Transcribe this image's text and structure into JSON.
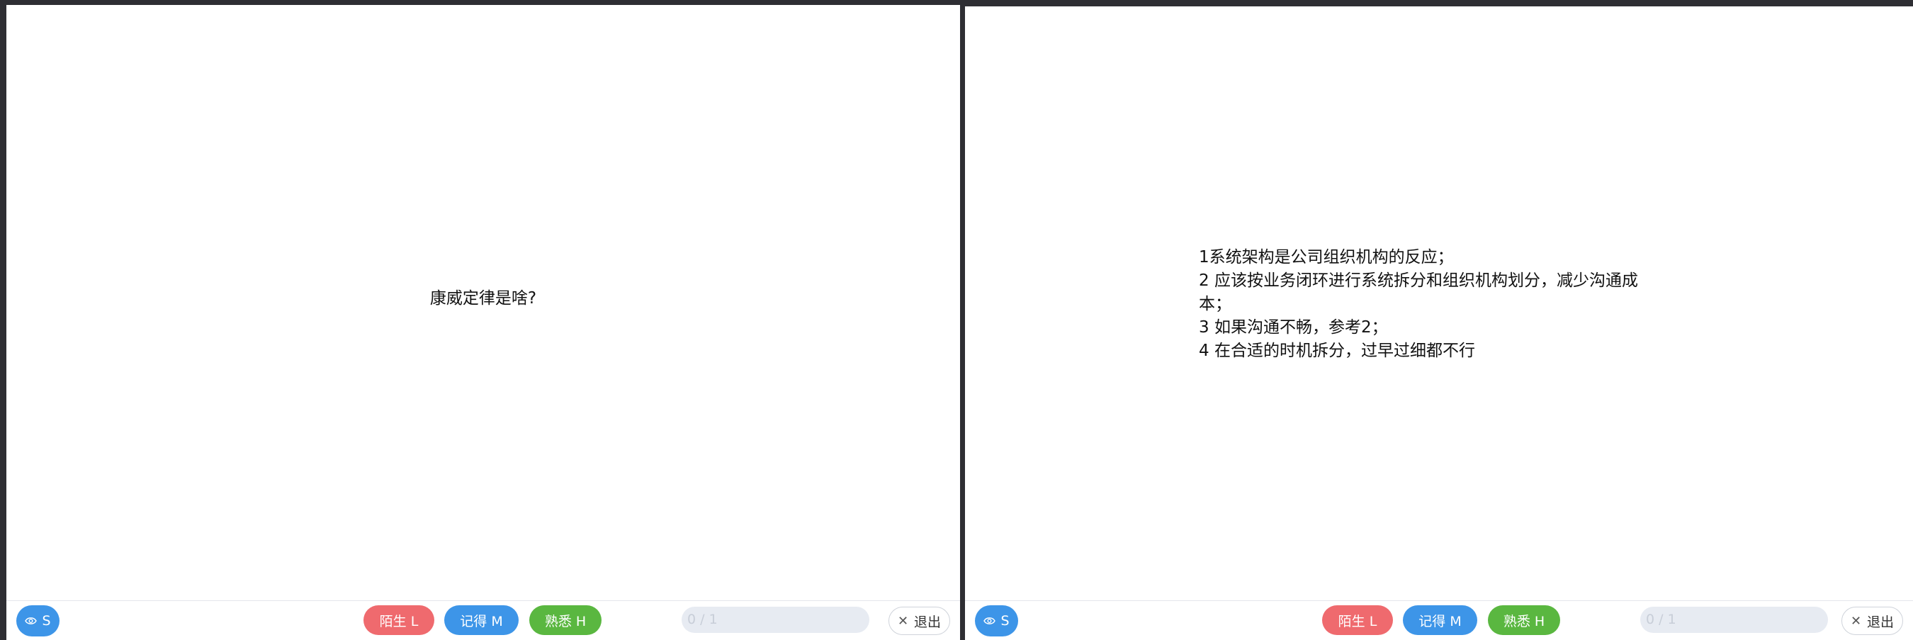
{
  "front": {
    "question": "康威定律是啥?"
  },
  "back": {
    "answer_lines": [
      "1系统架构是公司组织机构的反应；",
      "2 应该按业务闭环进行系统拆分和组织机构划分，减少沟通成本；",
      "3 如果沟通不畅，参考2；",
      "4 在合适的时机拆分，过早过细都不行"
    ]
  },
  "toolbar": {
    "show_label": "S",
    "show_icon": "eye-icon",
    "unfamiliar_label": "陌生 L",
    "remember_label": "记得 M",
    "familiar_label": "熟悉 H",
    "progress_text": "0 / 1",
    "exit_label": "退出",
    "exit_icon": "close-icon"
  },
  "colors": {
    "background": "#2e2e33",
    "blue": "#3d95e8",
    "red": "#ef6a6e",
    "green": "#5ab740"
  }
}
